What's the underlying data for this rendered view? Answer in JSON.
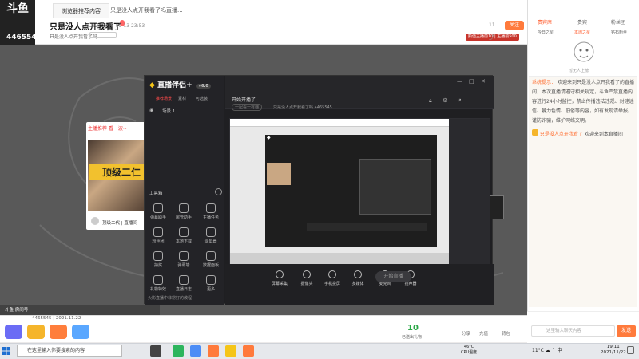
{
  "window": {
    "logo_text": "斗鱼",
    "room_id": "4465545",
    "tabs": [
      "浏览器推荐内容",
      "只是没人点开我看了吗直播..."
    ]
  },
  "stream": {
    "title": "只是没人点开我看了",
    "meta": "♀ 0   ◎ 2018-09-13 23:53",
    "streamer_name": "只是没人点开我看了吗",
    "follow_label": "关注",
    "follow_count": "11",
    "badge": "颜值主播前10 | 主播前500",
    "inset_header": "主播推荐 看一波~",
    "inset_banner": "顶级二仁",
    "inset_footer": "顶级二代 | 直播间"
  },
  "inner_app": {
    "brand": "直播伴侣",
    "brand_suffix": "+",
    "version": "v6.0",
    "tabs": [
      "推荐场景",
      "素材",
      "可选装"
    ],
    "scene_label": "场景 1",
    "tools_header": "工具箱",
    "tools": [
      {
        "label": "弹幕助手"
      },
      {
        "label": "房管助手"
      },
      {
        "label": "主播任务"
      },
      {
        "label": "粉丝团"
      },
      {
        "label": "本地下载"
      },
      {
        "label": "录屏器"
      },
      {
        "label": "抽奖"
      },
      {
        "label": "弹幕墙"
      },
      {
        "label": "数据面板"
      },
      {
        "label": "礼物特效"
      },
      {
        "label": "直播日志"
      },
      {
        "label": "更多"
      }
    ],
    "stream_title": "开始开播了",
    "stream_sub": "一起看一有趣",
    "room_line": "只是没人点开我看了吗  4465545",
    "bottom_hint": "火影直播中非常好的教程",
    "controls": [
      {
        "label": "屏幕采集"
      },
      {
        "label": "摄像头"
      },
      {
        "label": "手机投屏"
      },
      {
        "label": "多媒体"
      },
      {
        "label": "麦克风"
      },
      {
        "label": "扬声器"
      }
    ],
    "start_label": "开始直播"
  },
  "bottom_info": {
    "line1": "斗鱼 房间号",
    "line2": "4465545 | 2021.11.22",
    "gift_counter": "10",
    "gift_counter_label": "已送出礼物",
    "share_label": "分享",
    "recharge_label": "充值",
    "backpack_label": "背包"
  },
  "right_panel": {
    "tabs": [
      "贵宾席",
      "贵宾",
      "粉丝团"
    ],
    "sub_tabs": [
      "今日之星",
      "本周之星",
      "钻石粉丝"
    ],
    "avatar_caption": "暂无人上榜",
    "chat": [
      {
        "type": "system",
        "label": "系统提示：",
        "text": "欢迎来到只是没人点开我看了的直播间，本次直播请遵守相关规定，斗鱼严禁直播内容进行24小时监控，禁止传播违法违规、封建迷信、暴力色情、低俗等内容，如有发现请举报。谨防诈骗，维护网络文明。"
      },
      {
        "type": "welcome",
        "label": "只是没人点开我看了",
        "text": "欢迎来到本直播间"
      }
    ],
    "input_placeholder": "这里输入聊天内容",
    "send_label": "发送"
  },
  "taskbar": {
    "search_placeholder": "在这里输入你要搜索的内容",
    "weather_temp": "46°C",
    "weather_label": "CPU温度",
    "tray_text": "11°C ☁ ^ 中",
    "time": "19:11",
    "date": "2021/11/22"
  },
  "colors": {
    "accent": "#ff7a3c",
    "brand_yellow": "#f5c518",
    "badge_red": "#c8352c",
    "video_bg": "#595959"
  }
}
